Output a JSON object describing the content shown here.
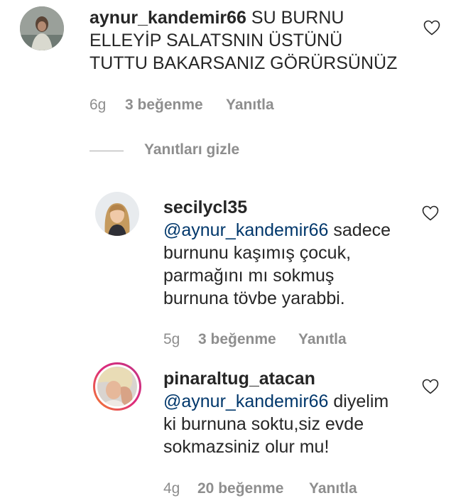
{
  "comments": [
    {
      "username": "aynur_kandemir66",
      "mention": "",
      "lines": [
        "SU BURNU",
        "ELLEYİP SALATSNIN ÜSTÜNÜ",
        "TUTTU BAKARSANIZ GÖRÜRSÜNÜZ"
      ],
      "time": "6g",
      "likes": "3 beğenme",
      "reply": "Yanıtla"
    },
    {
      "username": "secilycl35",
      "mention": "@aynur_kandemir66",
      "lines": [
        " sadece",
        "burnunu kaşımış çocuk,",
        "parmağını mı sokmuş",
        "burnuna tövbe yarabbi."
      ],
      "time": "5g",
      "likes": "3 beğenme",
      "reply": "Yanıtla"
    },
    {
      "username": "pinaraltug_atacan",
      "mention": "@aynur_kandemir66",
      "lines": [
        " diyelim",
        "ki burnuna soktu,siz evde",
        "sokmazsiniz olur mu!"
      ],
      "time": "4g",
      "likes": "20 beğenme",
      "reply": "Yanıtla"
    }
  ],
  "thread": {
    "hide_replies": "Yanıtları gizle"
  },
  "icons": {
    "like": "heart-icon"
  },
  "colors": {
    "text": "#262626",
    "meta": "#8e8e8e",
    "mention": "#00376b",
    "story_ring_start": "#f58529",
    "story_ring_end": "#dd2a7b"
  }
}
